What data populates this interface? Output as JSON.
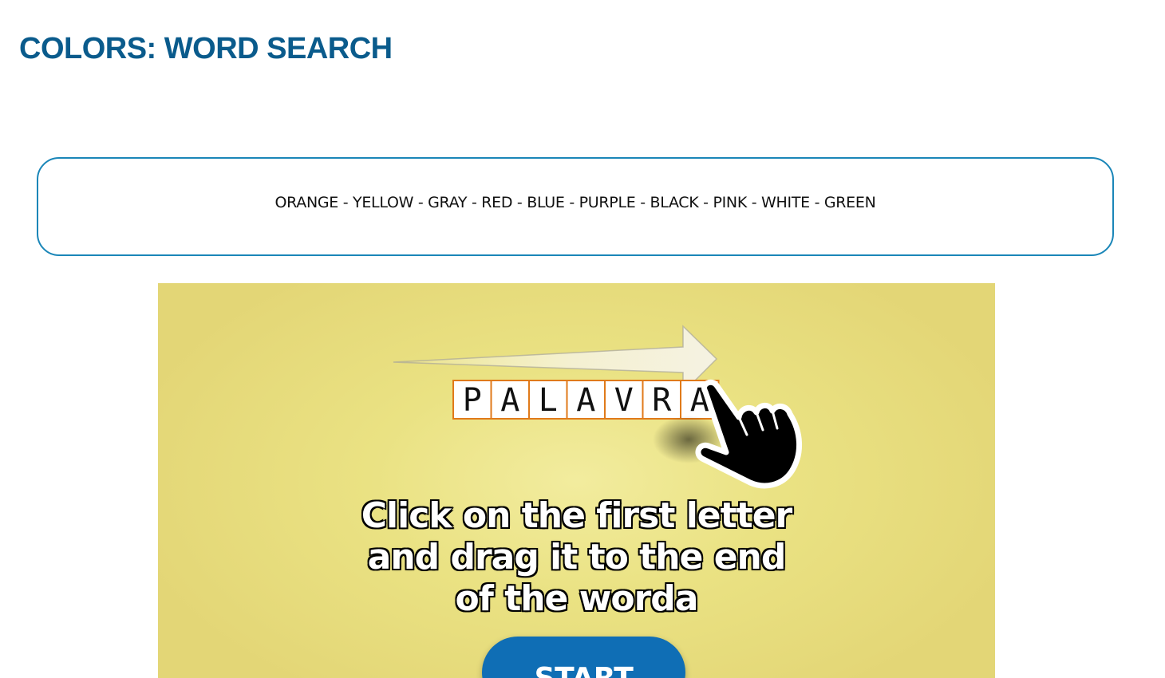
{
  "page": {
    "title": "COLORS: WORD SEARCH"
  },
  "word_list": {
    "text": "ORANGE - YELLOW - GRAY - RED - BLUE - PURPLE - BLACK - PINK - WHITE - GREEN"
  },
  "game": {
    "demo_letters": [
      "P",
      "A",
      "L",
      "A",
      "V",
      "R",
      "A"
    ],
    "instruction_lines": [
      "Click on the first letter",
      "and drag it to the end",
      "of the worda"
    ],
    "start_label": "START",
    "colors": {
      "background": "#e8df80",
      "cell_border": "#e07a1a",
      "button": "#0f6eb5",
      "title": "#0a5b8c",
      "box_border": "#1a86b8"
    },
    "icons": [
      "arrow-right-icon",
      "pointing-hand-icon"
    ]
  }
}
